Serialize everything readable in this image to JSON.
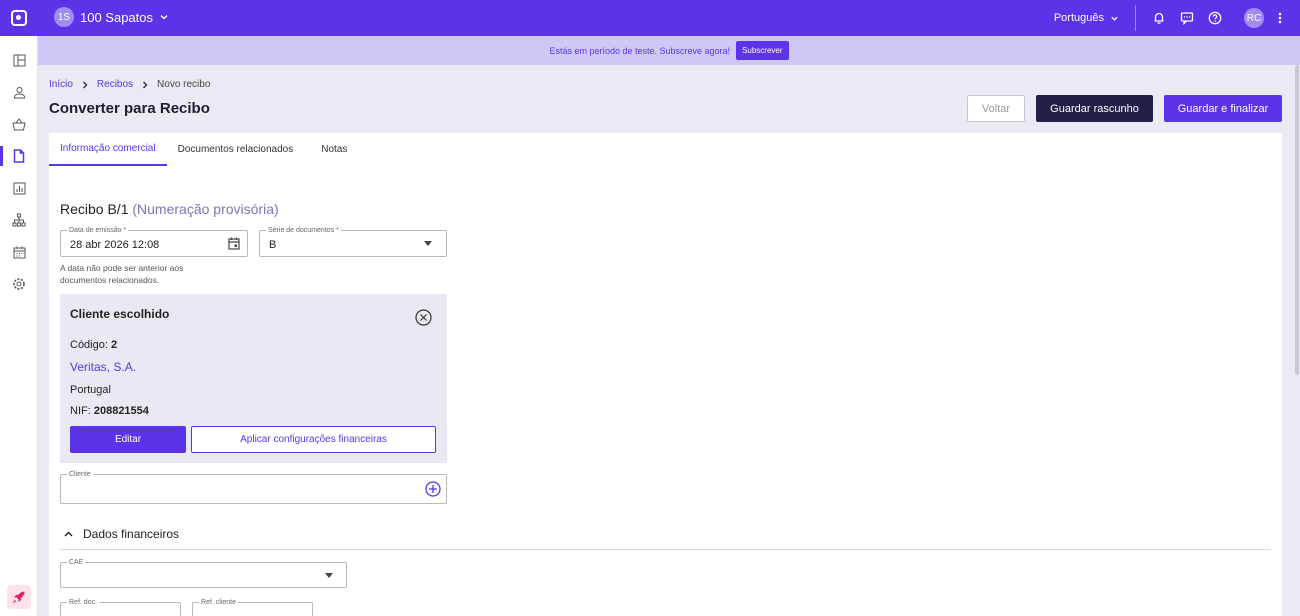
{
  "topbar": {
    "company_initials": "1S",
    "company_name": "100 Sapatos",
    "language": "Português",
    "user_initials": "RC"
  },
  "sidebar": {
    "items": [
      "dashboard",
      "contacts",
      "products",
      "documents",
      "reports",
      "organization",
      "calendar",
      "settings"
    ],
    "active": "documents"
  },
  "banner": {
    "message": "Estás em período de teste. Subscreve agora!",
    "button": "Subscrever"
  },
  "breadcrumb": {
    "home": "Início",
    "receipts": "Recibos",
    "current": "Novo recibo"
  },
  "page": {
    "title": "Converter para Recibo",
    "back_label": "Voltar",
    "save_draft_label": "Guardar rascunho",
    "save_finalize_label": "Guardar e finalizar"
  },
  "tabs": [
    {
      "label": "Informação comercial",
      "active": true
    },
    {
      "label": "Documentos relacionados",
      "active": false
    },
    {
      "label": "Notas",
      "active": false
    }
  ],
  "document": {
    "title": "Recibo B/1",
    "subtitle": "(Numeração provisória)",
    "issue_date_label": "Data de emissão *",
    "issue_date_value": "28 abr 2026 12:08",
    "series_label": "Série de documentos *",
    "series_value": "B",
    "date_hint": "A data não pode ser anterior aos documentos relacionados."
  },
  "client": {
    "box_title": "Cliente escolhido",
    "code_label": "Código:",
    "code_value": "2",
    "name": "Veritas, S.A.",
    "country": "Portugal",
    "nif_label": "NIF:",
    "nif_value": "208821554",
    "edit_label": "Editar",
    "apply_label": "Aplicar configurações financeiras",
    "field_label": "Cliente",
    "field_value": ""
  },
  "financial": {
    "section_title": "Dados financeiros",
    "cae_label": "CAE",
    "cae_value": "",
    "ref_doc_label": "Ref. doc.",
    "ref_client_label": "Ref. cliente"
  },
  "colors": {
    "brand": "#5b34ea",
    "dark_button": "#222046",
    "banner_bg": "#cfc8f7",
    "page_bg": "#eaeaf4"
  }
}
